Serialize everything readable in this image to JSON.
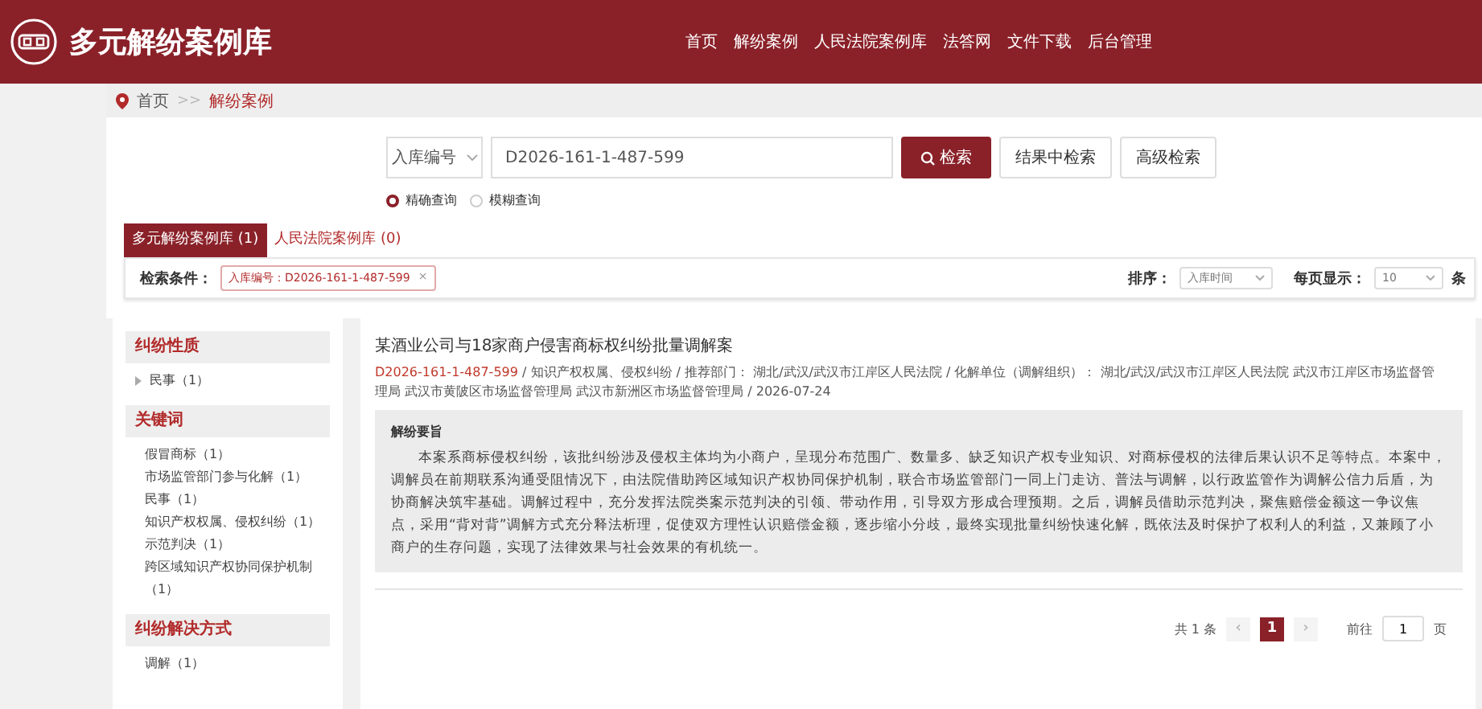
{
  "header": {
    "site_title": "多元解纷案例库",
    "nav": [
      "首页",
      "解纷案例",
      "人民法院案例库",
      "法答网",
      "文件下载",
      "后台管理"
    ]
  },
  "breadcrumb": [
    {
      "label": "首页",
      "selected": false
    },
    {
      "label": "解纷案例",
      "selected": true
    }
  ],
  "breadcrumb_separator": ">>",
  "search": {
    "field_type": "入库编号",
    "value": "D2026-161-1-487-599",
    "buttons": [
      {
        "label": "检索",
        "kind": "primary"
      },
      {
        "label": "结果中检索",
        "kind": "plain"
      },
      {
        "label": "高级检索",
        "kind": "plain"
      }
    ],
    "modes": [
      {
        "label": "精确查询",
        "selected": true
      },
      {
        "label": "模糊查询",
        "selected": false
      }
    ]
  },
  "library_tabs": [
    {
      "label": "多元解纷案例库 (1)",
      "selected": true
    },
    {
      "label": "人民法院案例库 (0)",
      "selected": false
    }
  ],
  "filter": {
    "label": "检索条件：",
    "tags": [
      {
        "text": "入库编号：D2026-161-1-487-599",
        "remove": "×"
      }
    ],
    "sort_label": "排序：",
    "sort_value": "入库时间",
    "page_size_label": "每页显示：",
    "page_size_value": "10",
    "page_size_unit": "条"
  },
  "sidebar": [
    {
      "title": "纠纷性质",
      "items": [
        {
          "label": "民事（1）",
          "kind": "expandable"
        }
      ]
    },
    {
      "title": "关键词",
      "items": [
        {
          "label": "假冒商标（1）",
          "kind": "plain"
        },
        {
          "label": "市场监管部门参与化解（1）",
          "kind": "plain"
        },
        {
          "label": "民事（1）",
          "kind": "plain"
        },
        {
          "label": "知识产权权属、侵权纠纷（1）",
          "kind": "plain"
        },
        {
          "label": "示范判决（1）",
          "kind": "plain"
        },
        {
          "label": "跨区域知识产权协同保护机制（1）",
          "kind": "plain"
        }
      ]
    },
    {
      "title": "纠纷解决方式",
      "items": [
        {
          "label": "调解（1）",
          "kind": "plain"
        }
      ]
    }
  ],
  "results": [
    {
      "title": "某酒业公司与18家商户侵害商标权纠纷批量调解案",
      "case_no": "D2026-161-1-487-599",
      "meta": "/ 知识产权权属、侵权纠纷 / 推荐部门： 湖北/武汉/武汉市江岸区人民法院 / 化解单位（调解组织）： 湖北/武汉/武汉市江岸区人民法院  武汉市江岸区市场监督管理局  武汉市黄陂区市场监督管理局  武汉市新洲区市场监督管理局 / 2026-07-24",
      "summary_title": "解纷要旨",
      "summary": "本案系商标侵权纠纷，该批纠纷涉及侵权主体均为小商户，呈现分布范围广、数量多、缺乏知识产权专业知识、对商标侵权的法律后果认识不足等特点。本案中，调解员在前期联系沟通受阻情况下，由法院借助跨区域知识产权协同保护机制，联合市场监管部门一同上门走访、普法与调解，以行政监管作为调解公信力后盾，为协商解决筑牢基础。调解过程中，充分发挥法院类案示范判决的引领、带动作用，引导双方形成合理预期。之后，调解员借助示范判决，聚焦赔偿金额这一争议焦点，采用“背对背”调解方式充分释法析理，促使双方理性认识赔偿金额，逐步缩小分歧，最终实现批量纠纷快速化解，既依法及时保护了权利人的利益，又兼顾了小商户的生存问题，实现了法律效果与社会效果的有机统一。"
    }
  ],
  "pagination": {
    "total": "共 1 条",
    "prev": "‹",
    "pages": [
      {
        "label": "1",
        "selected": true
      }
    ],
    "next": "›",
    "goto_label": "前往",
    "goto_value": "1",
    "goto_unit": "页"
  }
}
